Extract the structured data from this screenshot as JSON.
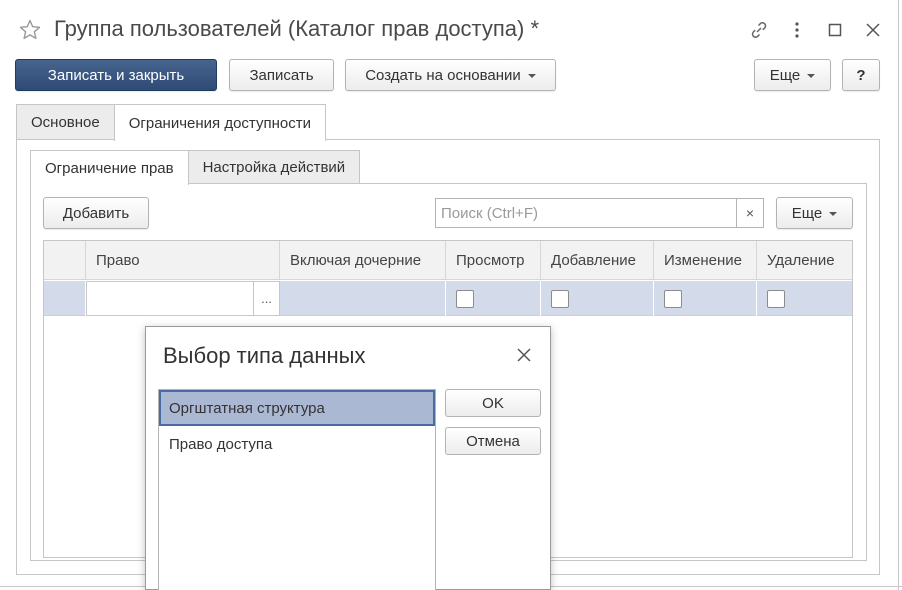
{
  "window": {
    "title": "Группа пользователей (Каталог прав доступа) *"
  },
  "toolbar": {
    "save_close_label": "Записать и закрыть",
    "save_label": "Записать",
    "create_based_label": "Создать на основании",
    "more_label": "Еще",
    "help_label": "?"
  },
  "tabs_outer": [
    {
      "label": "Основное",
      "active": false
    },
    {
      "label": "Ограничения доступности",
      "active": true
    }
  ],
  "tabs_inner": [
    {
      "label": "Ограничение прав",
      "active": true
    },
    {
      "label": "Настройка действий",
      "active": false
    }
  ],
  "table_toolbar": {
    "add_label": "Добавить",
    "search_placeholder": "Поиск (Ctrl+F)",
    "clear_label": "×",
    "more_label": "Еще"
  },
  "table": {
    "columns": [
      "Право",
      "Включая дочерние",
      "Просмотр",
      "Добавление",
      "Изменение",
      "Удаление"
    ],
    "rows": [
      {
        "right": "",
        "select_label": "...",
        "include_children": "",
        "view": false,
        "add": false,
        "edit": false,
        "delete": false
      }
    ]
  },
  "dialog": {
    "title": "Выбор типа данных",
    "items": [
      {
        "label": "Оргштатная структура",
        "selected": true
      },
      {
        "label": "Право доступа",
        "selected": false
      }
    ],
    "ok_label": "OK",
    "cancel_label": "Отмена"
  },
  "colors": {
    "primary_button": "#2e4b75",
    "selected_row": "#d3dbea",
    "dialog_selection": "#aab8d4"
  }
}
